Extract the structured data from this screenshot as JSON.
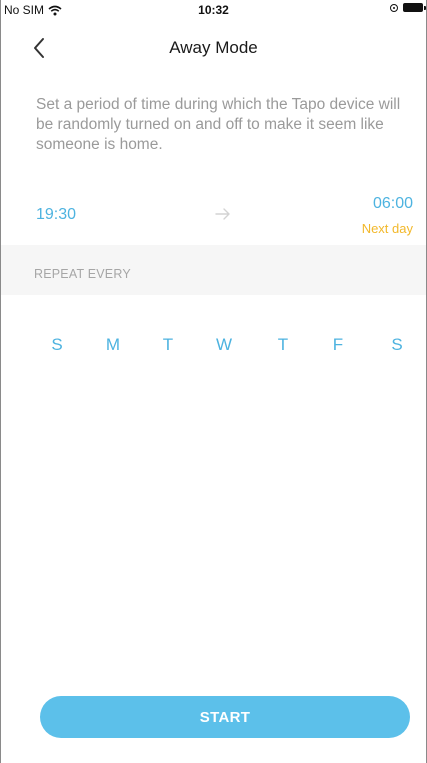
{
  "status_bar": {
    "carrier": "No SIM",
    "time": "10:32"
  },
  "header": {
    "title": "Away Mode",
    "back_icon": "chevron-left-icon"
  },
  "description": "Set a period of time during which the Tapo device will be randomly turned on and off to make it seem like someone is home.",
  "schedule": {
    "start_time": "19:30",
    "end_time": "06:00",
    "end_note": "Next day",
    "arrow_icon": "arrow-right-icon"
  },
  "repeat": {
    "label": "REPEAT EVERY",
    "days": [
      "S",
      "M",
      "T",
      "W",
      "T",
      "F",
      "S"
    ]
  },
  "actions": {
    "start_label": "START"
  },
  "colors": {
    "accent": "#4db3e0",
    "button": "#5cc0ea",
    "note": "#f2b82b",
    "muted": "#9a9a9a"
  }
}
